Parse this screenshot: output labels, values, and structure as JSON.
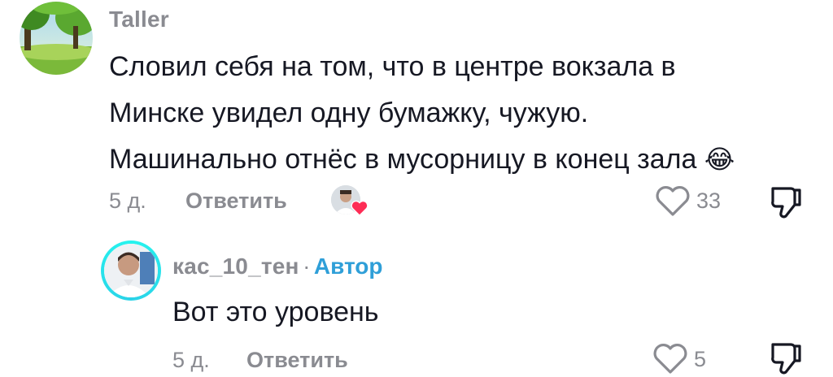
{
  "comment": {
    "username": "Taller",
    "text_lines": [
      "Словил себя на том, что в центре вокзала в",
      "Минске увидел одну бумажку, чужую.",
      "Машинально отнёс в мусорницу в конец зала"
    ],
    "emoji": "😂",
    "age": "5 д.",
    "reply_label": "Ответить",
    "like_count": "33",
    "liked_by_creator": true
  },
  "reply": {
    "username": "кас_10_тен",
    "separator": "·",
    "author_badge": "Автор",
    "text": "Вот это уровень",
    "age": "5 д.",
    "reply_label": "Ответить",
    "like_count": "5"
  },
  "colors": {
    "text": "#161823",
    "muted": "#8a8b91",
    "author": "#2f9fd8",
    "heart": "#fe2c55",
    "ring": "#25f4ee"
  },
  "icons": [
    "heart-outline-icon",
    "dislike-icon",
    "red-heart-icon"
  ]
}
